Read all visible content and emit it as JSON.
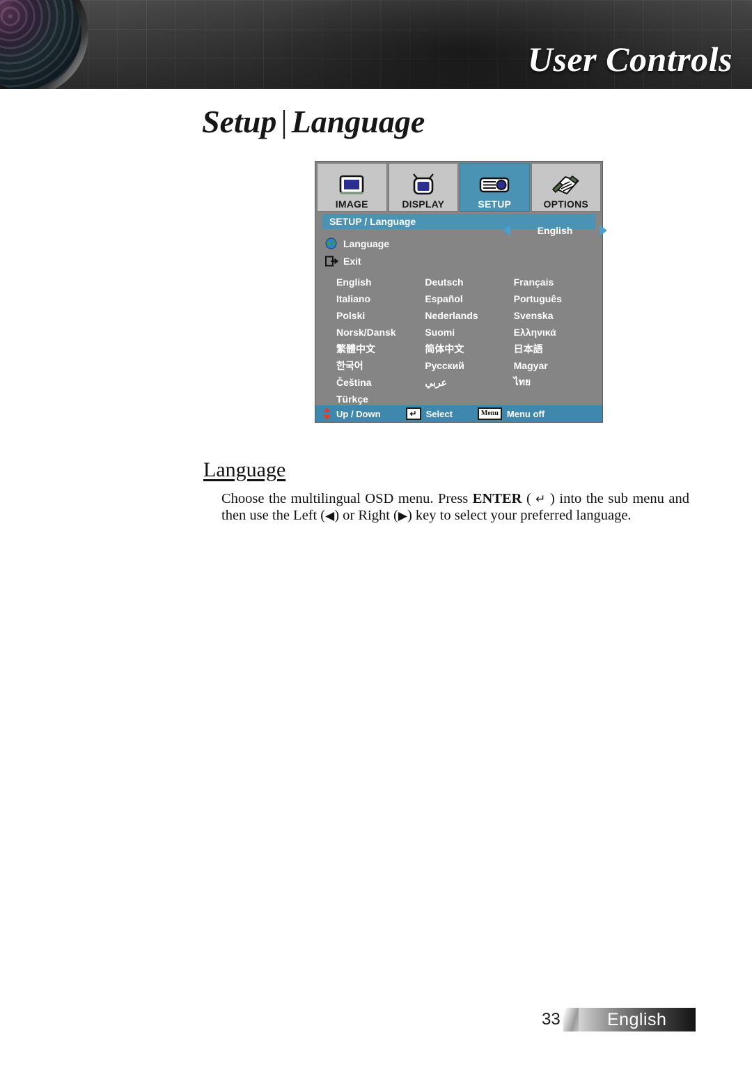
{
  "header": {
    "title": "User Controls",
    "logo_icon": "camera-lens-icon"
  },
  "page_title": {
    "section": "Setup",
    "separator": "|",
    "name": "Language"
  },
  "osd": {
    "tabs": [
      {
        "label": "IMAGE",
        "icon": "monitor-icon",
        "active": false
      },
      {
        "label": "DISPLAY",
        "icon": "tv-icon",
        "active": false
      },
      {
        "label": "SETUP",
        "icon": "projector-icon",
        "active": true
      },
      {
        "label": "OPTIONS",
        "icon": "notepad-pencil-icon",
        "active": false
      }
    ],
    "breadcrumb": "SETUP / Language",
    "rows": [
      {
        "icon": "globe-icon",
        "label": "Language",
        "value": "English",
        "left_arrow": "left-arrow-icon",
        "right_arrow": "right-arrow-icon"
      },
      {
        "icon": "exit-door-icon",
        "label": "Exit"
      }
    ],
    "language_rows": [
      [
        "English",
        "Deutsch",
        "Français"
      ],
      [
        "Italiano",
        "Español",
        "Português"
      ],
      [
        "Polski",
        "Nederlands",
        "Svenska"
      ],
      [
        "Norsk/Dansk",
        "Suomi",
        "Ελληνικά"
      ],
      [
        "繁體中文",
        "简体中文",
        "日本語"
      ],
      [
        "한국어",
        "Русский",
        "Magyar"
      ],
      [
        "Čeština",
        "عربي",
        "ไทย"
      ],
      [
        "Türkçe",
        "",
        ""
      ]
    ],
    "footer_hints": [
      {
        "icon": "up-down-arrows-icon",
        "label": "Up / Down"
      },
      {
        "icon": "enter-key-icon",
        "key": "↵",
        "label": "Select"
      },
      {
        "icon": "menu-key-icon",
        "key": "Menu",
        "label": "Menu off"
      }
    ],
    "colors": {
      "accent": "#4a93b5",
      "panel": "#858585",
      "footer_bar": "#3e88ad",
      "arrow": "#4a9fd0"
    }
  },
  "article": {
    "heading": "Language",
    "paragraph_part1": "Choose the multilingual OSD menu. Press ",
    "paragraph_enter": "ENTER",
    "paragraph_part2": " ( ",
    "enter_glyph": "↵",
    "paragraph_part3": " ) into the sub menu and then use the Left (",
    "left_glyph": "◀",
    "paragraph_part4": ") or Right (",
    "right_glyph": "▶",
    "paragraph_part5": ") key to select your preferred language."
  },
  "footer": {
    "page_number": "33",
    "language_banner": "English"
  }
}
